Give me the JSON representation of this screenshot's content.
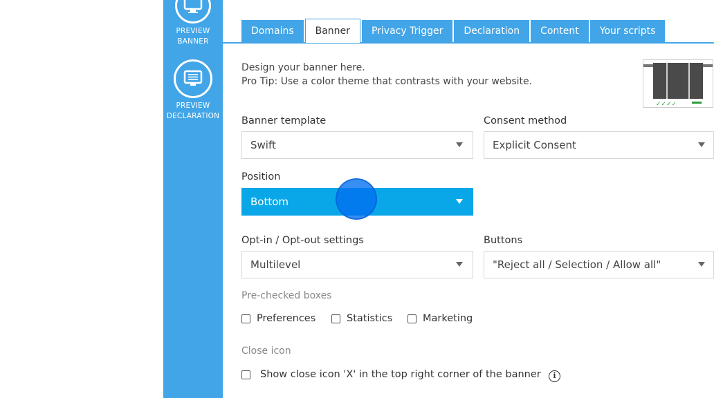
{
  "sidebar": {
    "preview_banner_line1": "PREVIEW",
    "preview_banner_line2": "BANNER",
    "preview_declaration_line1": "PREVIEW",
    "preview_declaration_line2": "DECLARATION"
  },
  "tabs": [
    "Domains",
    "Banner",
    "Privacy Trigger",
    "Declaration",
    "Content",
    "Your scripts"
  ],
  "active_tab": "Banner",
  "intro": {
    "line1": "Design your banner here.",
    "line2": "Pro Tip: Use a color theme that contrasts with your website."
  },
  "fields": {
    "banner_template": {
      "label": "Banner template",
      "value": "Swift"
    },
    "consent_method": {
      "label": "Consent method",
      "value": "Explicit Consent"
    },
    "position": {
      "label": "Position",
      "value": "Bottom"
    },
    "optin": {
      "label": "Opt-in / Opt-out settings",
      "value": "Multilevel"
    },
    "buttons": {
      "label": "Buttons",
      "value": "\"Reject all / Selection / Allow all\""
    }
  },
  "prechecked": {
    "label": "Pre-checked boxes",
    "options": [
      "Preferences",
      "Statistics",
      "Marketing"
    ]
  },
  "close_icon": {
    "label": "Close icon",
    "option": "Show close icon 'X' in the top right corner of the banner"
  },
  "colors": {
    "accent": "#42a5e8",
    "active_select": "#0aa7e8",
    "cursor": "#006ef0"
  }
}
